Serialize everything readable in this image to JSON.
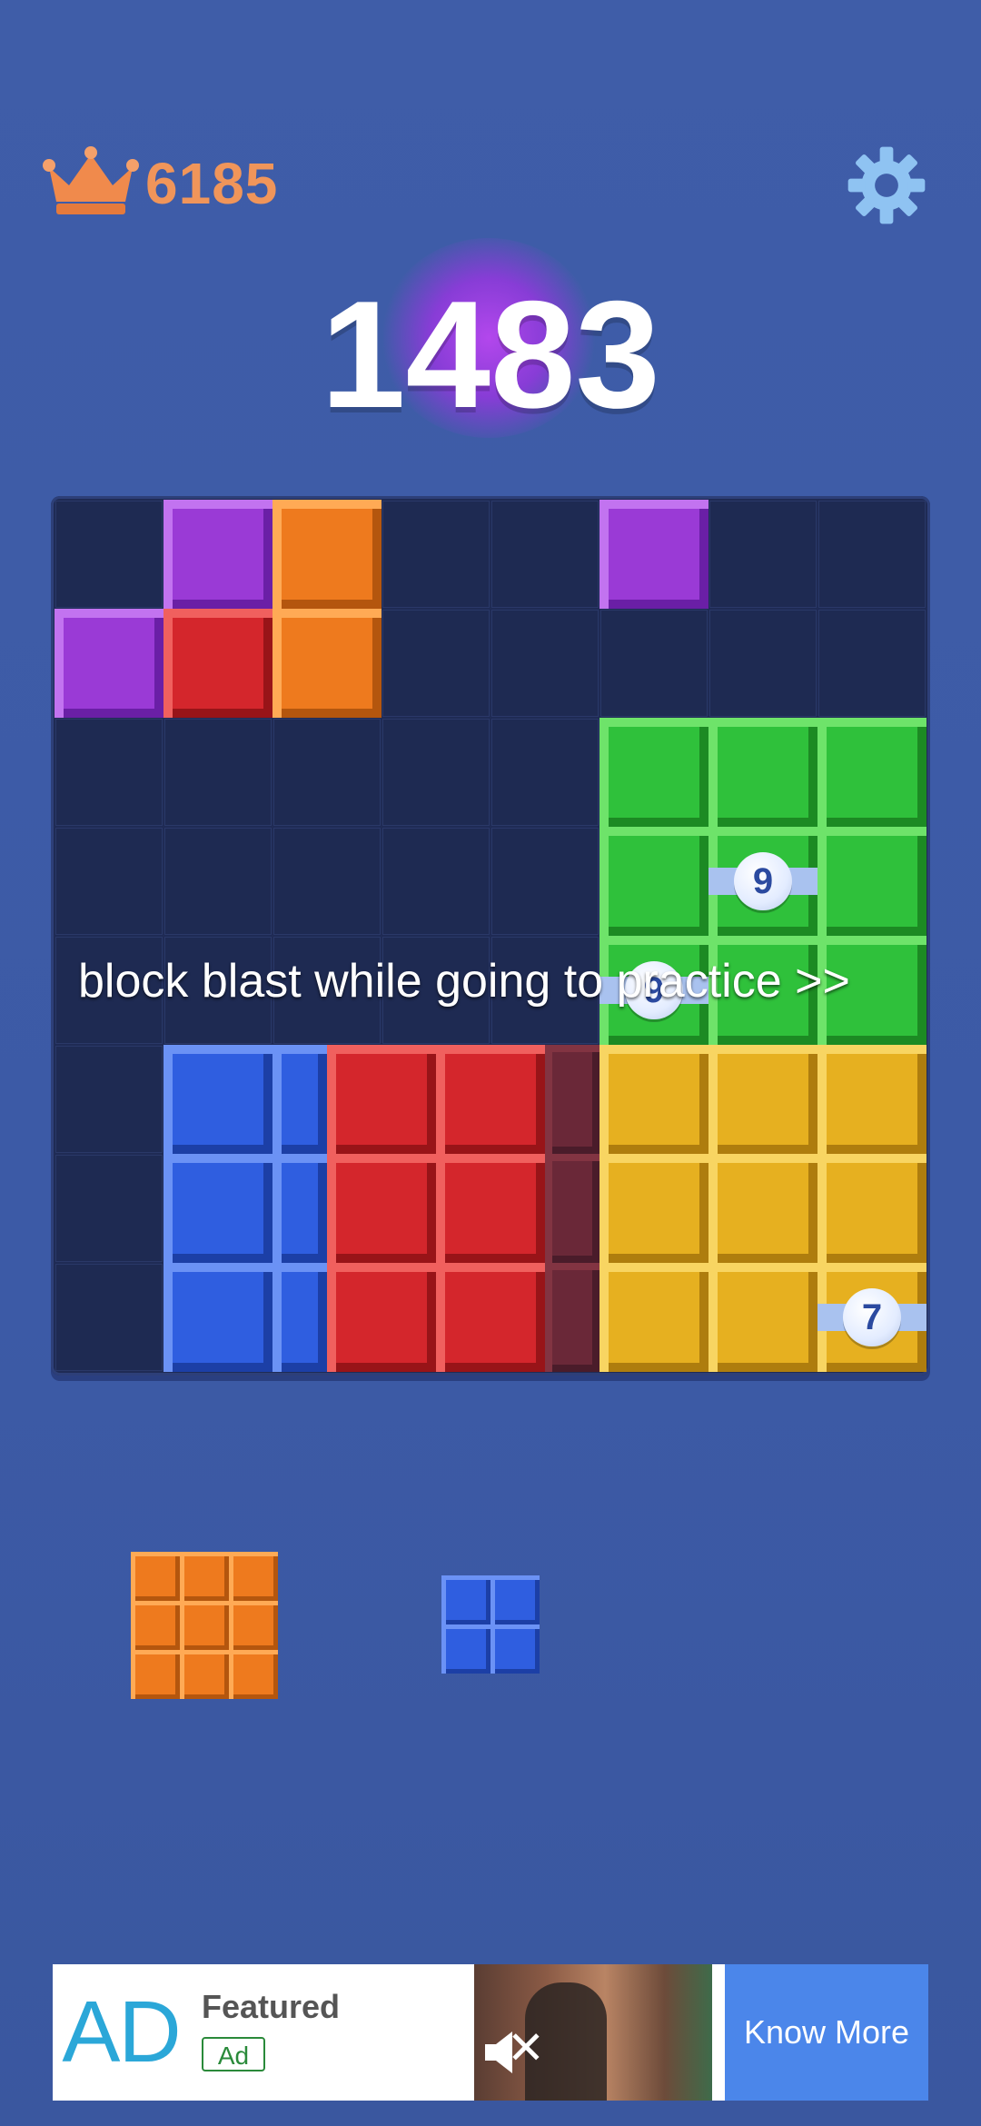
{
  "header": {
    "best_score": "6185",
    "current_score": "1483",
    "crown_icon": "crown-icon",
    "settings_icon": "gear-icon"
  },
  "board": {
    "size": "8x8",
    "colors": {
      "purple": "#9a3ad6",
      "orange": "#ee7a1e",
      "red": "#d4262c",
      "green": "#2fc13b",
      "blue": "#2f5ee0",
      "yellow": "#e6b020"
    },
    "cells": [
      {
        "row": 0,
        "col": 1,
        "color": "purple"
      },
      {
        "row": 0,
        "col": 2,
        "color": "orange"
      },
      {
        "row": 0,
        "col": 5,
        "color": "purple"
      },
      {
        "row": 1,
        "col": 0,
        "color": "purple"
      },
      {
        "row": 1,
        "col": 1,
        "color": "red"
      },
      {
        "row": 1,
        "col": 2,
        "color": "orange"
      },
      {
        "row": 2,
        "col": 5,
        "color": "green"
      },
      {
        "row": 2,
        "col": 6,
        "color": "green"
      },
      {
        "row": 2,
        "col": 7,
        "color": "green"
      },
      {
        "row": 3,
        "col": 5,
        "color": "green"
      },
      {
        "row": 3,
        "col": 6,
        "color": "green"
      },
      {
        "row": 3,
        "col": 7,
        "color": "green"
      },
      {
        "row": 4,
        "col": 5,
        "color": "green"
      },
      {
        "row": 4,
        "col": 6,
        "color": "green"
      },
      {
        "row": 4,
        "col": 7,
        "color": "green"
      },
      {
        "row": 5,
        "col": 5,
        "color": "yellow"
      },
      {
        "row": 5,
        "col": 6,
        "color": "yellow"
      },
      {
        "row": 5,
        "col": 7,
        "color": "yellow"
      },
      {
        "row": 6,
        "col": 5,
        "color": "yellow"
      },
      {
        "row": 6,
        "col": 6,
        "color": "yellow"
      },
      {
        "row": 6,
        "col": 7,
        "color": "yellow"
      },
      {
        "row": 7,
        "col": 5,
        "color": "yellow"
      },
      {
        "row": 7,
        "col": 6,
        "color": "yellow"
      },
      {
        "row": 7,
        "col": 7,
        "color": "yellow"
      }
    ],
    "badges": [
      {
        "row": 3,
        "col": 6,
        "value": "9"
      },
      {
        "row": 4,
        "col": 5,
        "value": "9"
      },
      {
        "row": 7,
        "col": 7,
        "value": "7"
      }
    ]
  },
  "overlay_caption": "block blast while going to practice >>",
  "tray": {
    "pieces": [
      {
        "name": "orange-3x3",
        "color": "orange"
      },
      {
        "name": "blue-2x2",
        "color": "blue"
      }
    ]
  },
  "ad": {
    "logo_text": "AD",
    "featured_label": "Featured",
    "ad_badge": "Ad",
    "cta_label": "Know More",
    "close_symbol": "✕"
  }
}
